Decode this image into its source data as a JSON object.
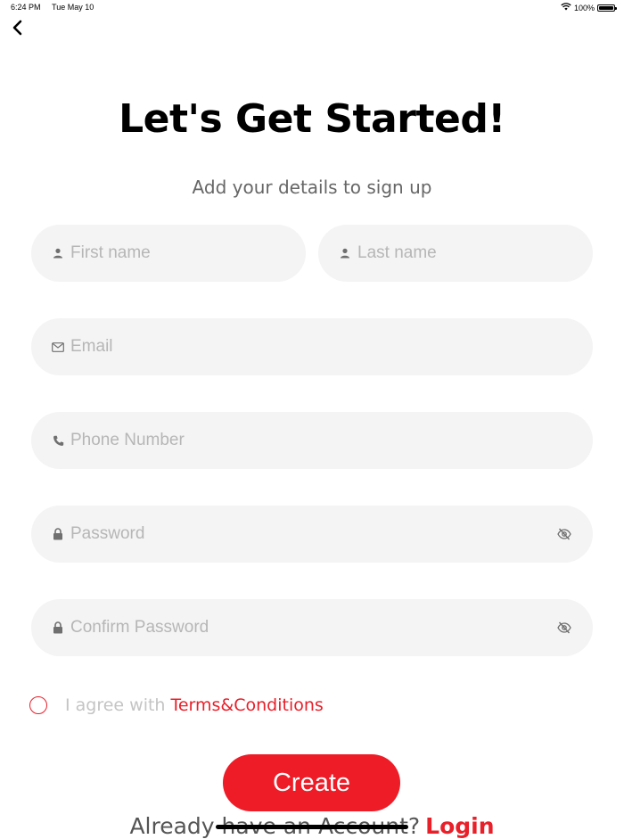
{
  "status_bar": {
    "time": "6:24 PM",
    "date": "Tue May 10",
    "battery": "100%",
    "battery_level": 1.0,
    "icons": [
      "wifi-icon",
      "battery-icon"
    ]
  },
  "header": {
    "back_icon": "chevron-left-icon",
    "title": "Let's Get Started!",
    "subtitle": "Add your details to sign up"
  },
  "form": {
    "first_name": {
      "placeholder": "First name",
      "value": "",
      "icon": "person-icon"
    },
    "last_name": {
      "placeholder": "Last name",
      "value": "",
      "icon": "person-icon"
    },
    "email": {
      "placeholder": "Email",
      "value": "",
      "icon": "envelope-icon"
    },
    "phone": {
      "placeholder": "Phone Number",
      "value": "",
      "icon": "phone-icon"
    },
    "password": {
      "placeholder": "Password",
      "value": "",
      "icon": "lock-icon",
      "toggle_icon": "eye-slash-icon"
    },
    "confirm_password": {
      "placeholder": "Confirm Password",
      "value": "",
      "icon": "lock-icon",
      "toggle_icon": "eye-slash-icon"
    }
  },
  "terms": {
    "prefix": "I agree with",
    "link_label": "Terms&Conditions",
    "checked": false
  },
  "actions": {
    "create_label": "Create"
  },
  "footer": {
    "prompt": "Already have an Account?",
    "login_label": "Login"
  },
  "colors": {
    "accent": "#ee1c27",
    "field_bg": "#f4f4f4",
    "placeholder": "#b6b6b6",
    "subtitle": "#666666"
  }
}
